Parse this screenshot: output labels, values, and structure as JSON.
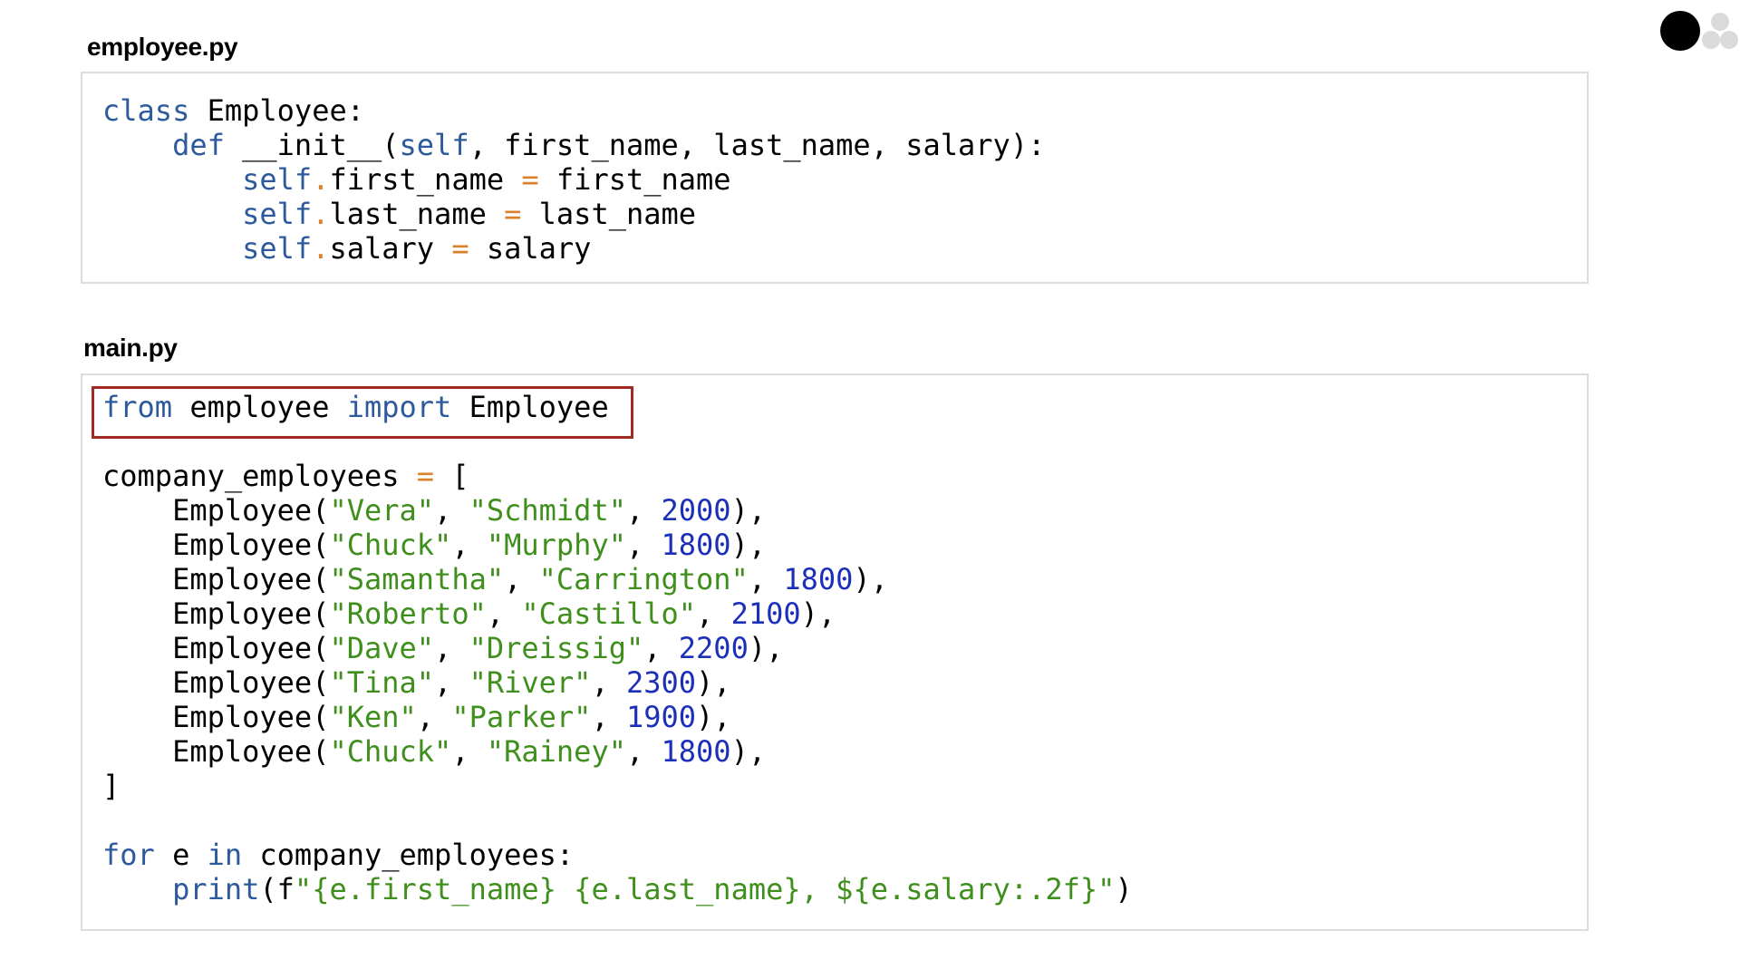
{
  "files": {
    "employee": {
      "title": "employee.py",
      "lines": [
        [
          {
            "t": "class",
            "c": "kw"
          },
          {
            "t": " Employee:"
          }
        ],
        [
          {
            "t": "    "
          },
          {
            "t": "def",
            "c": "kw"
          },
          {
            "t": " __init__("
          },
          {
            "t": "self",
            "c": "kw"
          },
          {
            "t": ", first_name, last_name, salary):"
          }
        ],
        [
          {
            "t": "        "
          },
          {
            "t": "self",
            "c": "kw"
          },
          {
            "t": ".",
            "c": "op"
          },
          {
            "t": "first_name "
          },
          {
            "t": "=",
            "c": "op"
          },
          {
            "t": " first_name"
          }
        ],
        [
          {
            "t": "        "
          },
          {
            "t": "self",
            "c": "kw"
          },
          {
            "t": ".",
            "c": "op"
          },
          {
            "t": "last_name "
          },
          {
            "t": "=",
            "c": "op"
          },
          {
            "t": " last_name"
          }
        ],
        [
          {
            "t": "        "
          },
          {
            "t": "self",
            "c": "kw"
          },
          {
            "t": ".",
            "c": "op"
          },
          {
            "t": "salary "
          },
          {
            "t": "=",
            "c": "op"
          },
          {
            "t": " salary"
          }
        ]
      ]
    },
    "main": {
      "title": "main.py",
      "lines": [
        [
          {
            "t": "from",
            "c": "kw"
          },
          {
            "t": " employee "
          },
          {
            "t": "import",
            "c": "kw"
          },
          {
            "t": " Employee"
          }
        ],
        [],
        [
          {
            "t": "company_employees "
          },
          {
            "t": "=",
            "c": "op"
          },
          {
            "t": " ["
          }
        ],
        [
          {
            "t": "    Employee("
          },
          {
            "t": "\"Vera\"",
            "c": "str"
          },
          {
            "t": ", "
          },
          {
            "t": "\"Schmidt\"",
            "c": "str"
          },
          {
            "t": ", "
          },
          {
            "t": "2000",
            "c": "num"
          },
          {
            "t": "),"
          }
        ],
        [
          {
            "t": "    Employee("
          },
          {
            "t": "\"Chuck\"",
            "c": "str"
          },
          {
            "t": ", "
          },
          {
            "t": "\"Murphy\"",
            "c": "str"
          },
          {
            "t": ", "
          },
          {
            "t": "1800",
            "c": "num"
          },
          {
            "t": "),"
          }
        ],
        [
          {
            "t": "    Employee("
          },
          {
            "t": "\"Samantha\"",
            "c": "str"
          },
          {
            "t": ", "
          },
          {
            "t": "\"Carrington\"",
            "c": "str"
          },
          {
            "t": ", "
          },
          {
            "t": "1800",
            "c": "num"
          },
          {
            "t": "),"
          }
        ],
        [
          {
            "t": "    Employee("
          },
          {
            "t": "\"Roberto\"",
            "c": "str"
          },
          {
            "t": ", "
          },
          {
            "t": "\"Castillo\"",
            "c": "str"
          },
          {
            "t": ", "
          },
          {
            "t": "2100",
            "c": "num"
          },
          {
            "t": "),"
          }
        ],
        [
          {
            "t": "    Employee("
          },
          {
            "t": "\"Dave\"",
            "c": "str"
          },
          {
            "t": ", "
          },
          {
            "t": "\"Dreissig\"",
            "c": "str"
          },
          {
            "t": ", "
          },
          {
            "t": "2200",
            "c": "num"
          },
          {
            "t": "),"
          }
        ],
        [
          {
            "t": "    Employee("
          },
          {
            "t": "\"Tina\"",
            "c": "str"
          },
          {
            "t": ", "
          },
          {
            "t": "\"River\"",
            "c": "str"
          },
          {
            "t": ", "
          },
          {
            "t": "2300",
            "c": "num"
          },
          {
            "t": "),"
          }
        ],
        [
          {
            "t": "    Employee("
          },
          {
            "t": "\"Ken\"",
            "c": "str"
          },
          {
            "t": ", "
          },
          {
            "t": "\"Parker\"",
            "c": "str"
          },
          {
            "t": ", "
          },
          {
            "t": "1900",
            "c": "num"
          },
          {
            "t": "),"
          }
        ],
        [
          {
            "t": "    Employee("
          },
          {
            "t": "\"Chuck\"",
            "c": "str"
          },
          {
            "t": ", "
          },
          {
            "t": "\"Rainey\"",
            "c": "str"
          },
          {
            "t": ", "
          },
          {
            "t": "1800",
            "c": "num"
          },
          {
            "t": "),"
          }
        ],
        [
          {
            "t": "]"
          }
        ],
        [],
        [
          {
            "t": "for",
            "c": "kw"
          },
          {
            "t": " e "
          },
          {
            "t": "in",
            "c": "kw"
          },
          {
            "t": " company_employees:"
          }
        ],
        [
          {
            "t": "    "
          },
          {
            "t": "print",
            "c": "kw"
          },
          {
            "t": "(f"
          },
          {
            "t": "\"{e.first_name} {e.last_name}, ${e.salary:.2f}\"",
            "c": "str"
          },
          {
            "t": ")"
          }
        ]
      ]
    }
  },
  "colors": {
    "keyword": "#2c5a9c",
    "operator": "#d9822b",
    "string": "#3f8f1d",
    "number": "#1c2fb8",
    "highlight_box": "#a32a22",
    "panel_border": "#dcdcdc"
  },
  "slide_nav": {
    "dots": [
      "active",
      "inactive",
      "inactive",
      "inactive"
    ]
  }
}
